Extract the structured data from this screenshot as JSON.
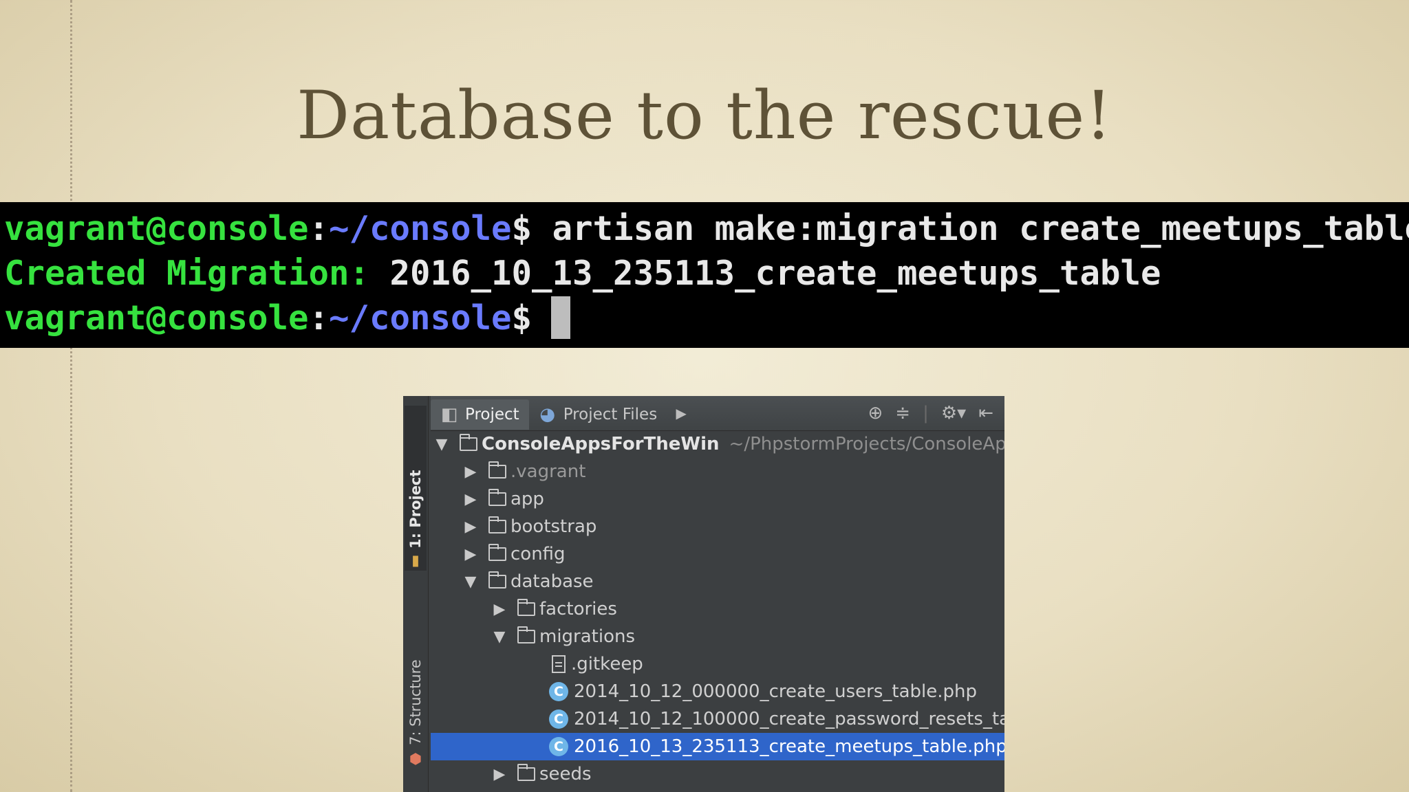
{
  "slide": {
    "title": "Database to the rescue!"
  },
  "terminal": {
    "line1": {
      "user_host": "vagrant@console",
      "sep": ":",
      "path": "~/console",
      "prompt": "$",
      "command": " artisan make:migration create_meetups_table"
    },
    "line2": {
      "label": "Created Migration:",
      "value": " 2016_10_13_235113_create_meetups_table"
    },
    "line3": {
      "user_host": "vagrant@console",
      "sep": ":",
      "path": "~/console",
      "prompt": "$"
    }
  },
  "ide": {
    "side_tabs": {
      "project": "1: Project",
      "structure": "7: Structure"
    },
    "tabs": {
      "project": "Project",
      "project_files": "Project Files"
    },
    "tree": {
      "root": {
        "name": "ConsoleAppsForTheWin",
        "path": "~/PhpstormProjects/ConsoleApps"
      },
      "vagrant": ".vagrant",
      "app": "app",
      "bootstrap": "bootstrap",
      "config": "config",
      "database": "database",
      "factories": "factories",
      "migrations": "migrations",
      "gitkeep": ".gitkeep",
      "m1": "2014_10_12_000000_create_users_table.php",
      "m2": "2014_10_12_100000_create_password_resets_ta",
      "m3": "2016_10_13_235113_create_meetups_table.php",
      "seeds": "seeds"
    },
    "icons": {
      "class_letter": "C"
    }
  }
}
